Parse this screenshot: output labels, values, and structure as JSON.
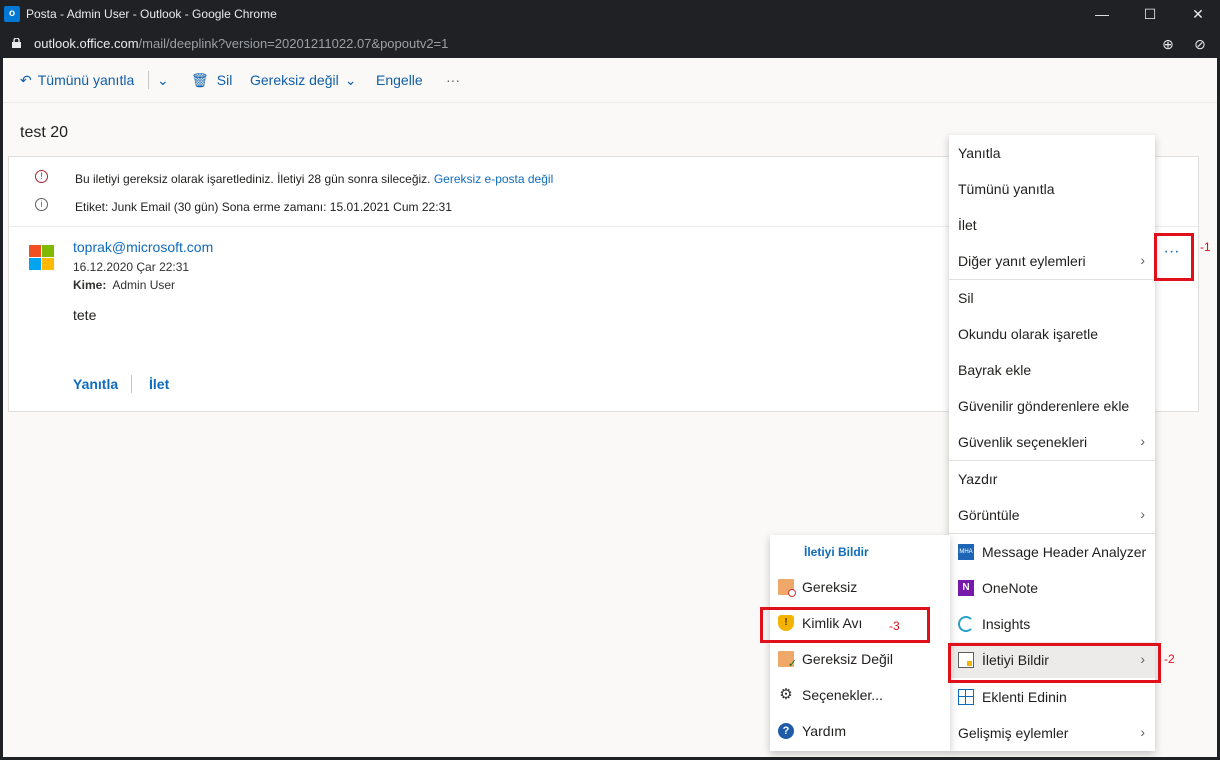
{
  "window": {
    "title": "Posta - Admin User - Outlook - Google Chrome",
    "app_icon": "outlook-icon",
    "url_host": "outlook.office.com",
    "url_path": "/mail/deeplink?version=20201211022.07&popoutv2=1"
  },
  "toolbar": {
    "reply_all": "Tümünü yanıtla",
    "delete": "Sil",
    "not_junk": "Gereksiz değil",
    "block": "Engelle",
    "more": "···"
  },
  "message": {
    "subject": "test 20",
    "junk_notice": "Bu iletiyi gereksiz olarak işaretlediniz. İletiyi 28 gün sonra sileceğiz.",
    "junk_link": "Gereksiz e-posta değil",
    "retention": "Etiket: Junk Email (30 gün) Sona erme zamanı: 15.01.2021 Cum 22:31",
    "sender": "toprak@microsoft.com",
    "date": "16.12.2020 Çar 22:31",
    "to_label": "Kime:",
    "to_value": "Admin User",
    "body": "tete",
    "reply": "Yanıtla",
    "forward": "İlet",
    "more_dots": "···"
  },
  "main_menu": {
    "items": [
      {
        "label": "Yanıtla"
      },
      {
        "label": "Tümünü yanıtla"
      },
      {
        "label": "İlet"
      },
      {
        "label": "Diğer yanıt eylemleri"
      },
      {
        "label": "Sil"
      },
      {
        "label": "Okundu olarak işaretle"
      },
      {
        "label": "Bayrak ekle"
      },
      {
        "label": "Güvenilir gönderenlere ekle"
      },
      {
        "label": "Güvenlik seçenekleri"
      },
      {
        "label": "Yazdır"
      },
      {
        "label": "Görüntüle"
      },
      {
        "label": "Message Header Analyzer",
        "icon": "mha-icon"
      },
      {
        "label": "OneNote",
        "icon": "onenote-icon"
      },
      {
        "label": "Insights",
        "icon": "insights-icon"
      },
      {
        "label": "İletiyi Bildir",
        "icon": "report-message-icon"
      },
      {
        "label": "Eklenti Edinin",
        "icon": "get-addins-icon"
      },
      {
        "label": "Gelişmiş eylemler"
      }
    ]
  },
  "sub_menu": {
    "header": "İletiyi Bildir",
    "items": [
      {
        "label": "Gereksiz",
        "icon": "junk-icon"
      },
      {
        "label": "Kimlik Avı",
        "icon": "phishing-icon"
      },
      {
        "label": "Gereksiz Değil",
        "icon": "not-junk-icon"
      },
      {
        "label": "Seçenekler...",
        "icon": "gear-icon"
      },
      {
        "label": "Yardım",
        "icon": "help-icon"
      }
    ]
  },
  "annotations": {
    "step1": "-1",
    "step2": "-2",
    "step3": "-3",
    "color": "#e0101a"
  },
  "colors": {
    "accent": "#0f6cbd",
    "chrome_bg": "#202124"
  }
}
